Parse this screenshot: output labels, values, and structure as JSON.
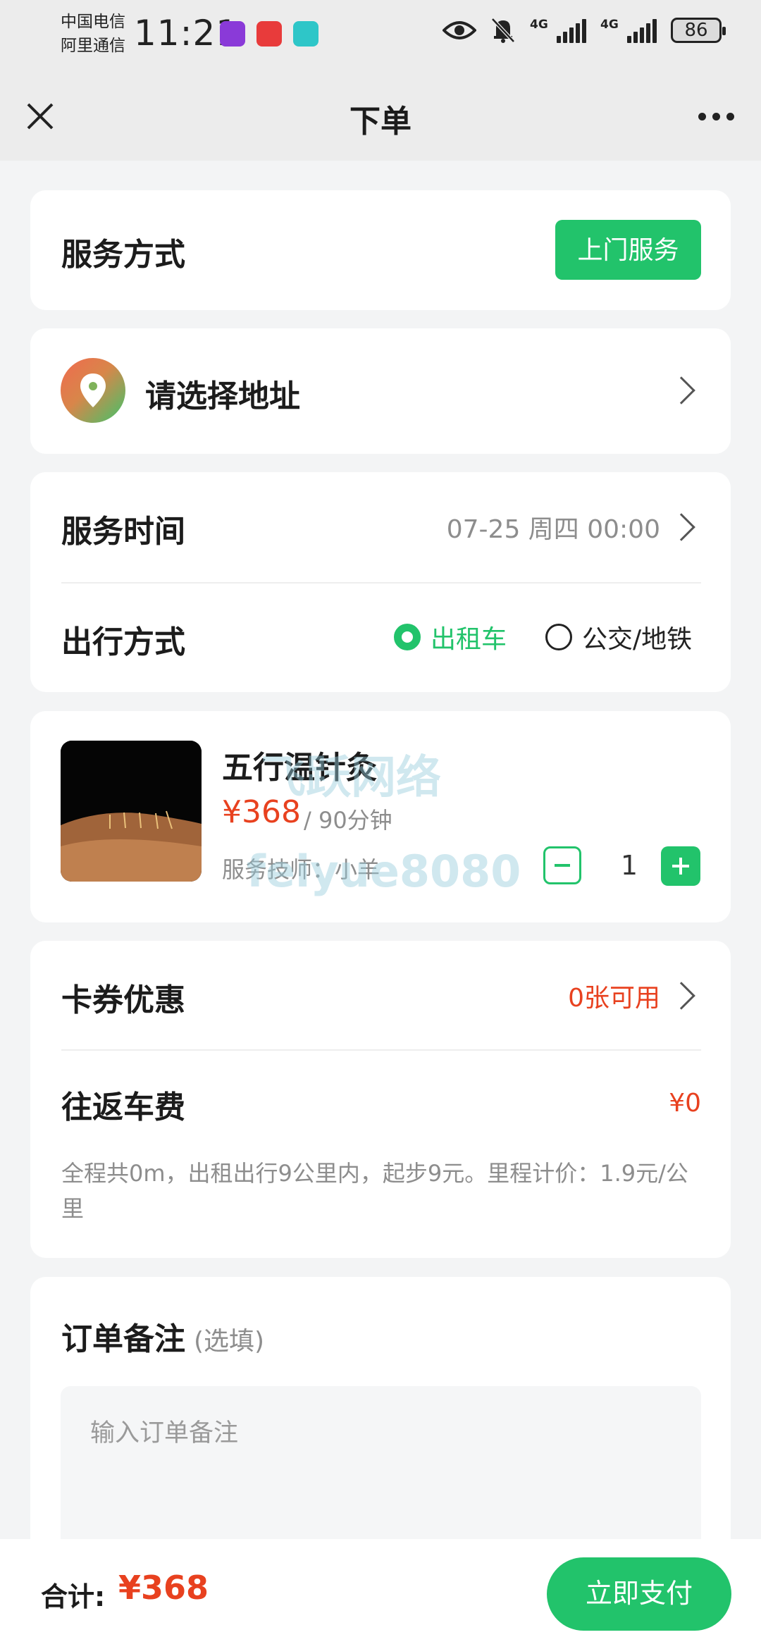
{
  "status_bar": {
    "carrier1": "中国电信",
    "carrier2": "阿里通信",
    "time": "11:21",
    "network1": "4G",
    "network2": "4G",
    "battery": "86",
    "icons": [
      "eye-icon",
      "bell-off-icon",
      "signal-icon",
      "battery-icon"
    ]
  },
  "nav": {
    "title": "下单"
  },
  "service_mode": {
    "label": "服务方式",
    "button": "上门服务"
  },
  "address": {
    "label": "请选择地址"
  },
  "service_time": {
    "label": "服务时间",
    "value": "07-25 周四 00:00"
  },
  "travel": {
    "label": "出行方式",
    "options": [
      "出租车",
      "公交/地铁"
    ],
    "selected": "出租车"
  },
  "product": {
    "name": "五行温针灸",
    "price": "¥368",
    "duration": "/ 90分钟",
    "technician": "服务技师：小羊",
    "quantity": "1"
  },
  "coupon": {
    "label": "卡券优惠",
    "value": "0张可用"
  },
  "fare": {
    "label": "往返车费",
    "value": "¥0",
    "note": "全程共0m，出租出行9公里内，起步9元。里程计价：1.9元/公里"
  },
  "remark": {
    "label": "订单备注",
    "optional": "(选填)",
    "placeholder": "输入订单备注"
  },
  "footer": {
    "total_label": "合计:",
    "total_value": "¥368",
    "pay_button": "立即支付"
  },
  "colors": {
    "accent": "#22c36b",
    "price": "#e8411f",
    "background": "#f3f4f5"
  }
}
